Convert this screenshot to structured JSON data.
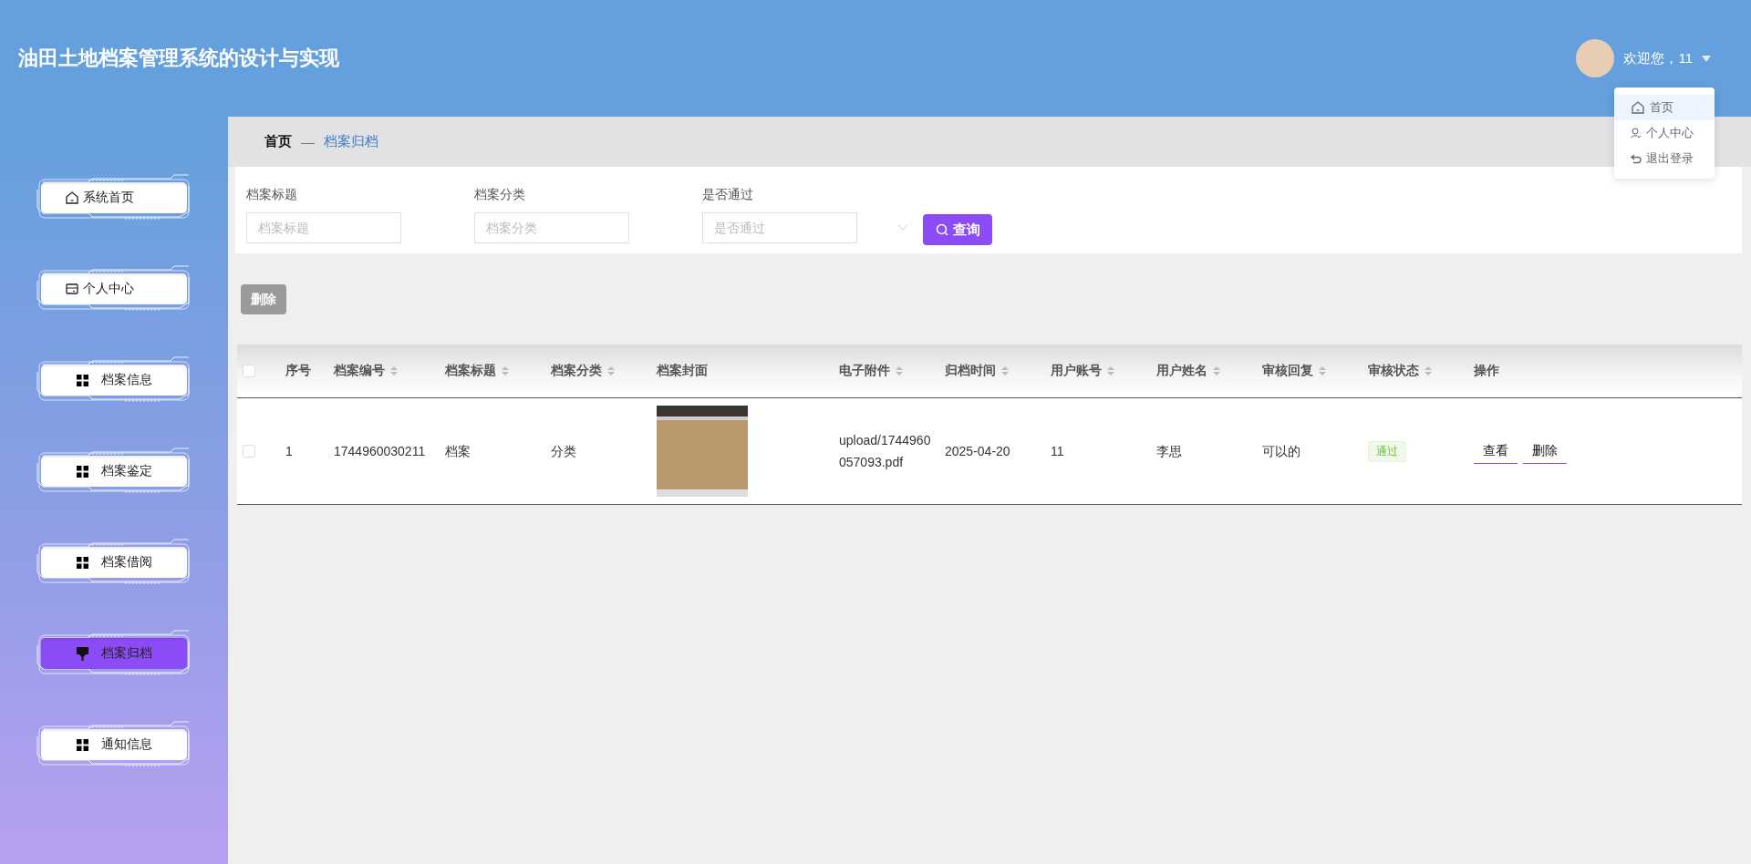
{
  "header": {
    "title": "油田土地档案管理系统的设计与实现",
    "greeting": "欢迎您，11",
    "menu": [
      {
        "label": "首页",
        "kind": "home",
        "selected": true
      },
      {
        "label": "个人中心",
        "kind": "user",
        "selected": false
      },
      {
        "label": "退出登录",
        "kind": "back",
        "selected": false
      }
    ]
  },
  "sidebar": {
    "items": [
      {
        "label": "系统首页",
        "kind": "home",
        "selected": false
      },
      {
        "label": "个人中心",
        "kind": "card",
        "selected": false
      },
      {
        "label": "档案信息",
        "kind": "grid",
        "selected": false
      },
      {
        "label": "档案鉴定",
        "kind": "grid",
        "selected": false
      },
      {
        "label": "档案借阅",
        "kind": "grid",
        "selected": false
      },
      {
        "label": "档案归档",
        "kind": "brush",
        "selected": true
      },
      {
        "label": "通知信息",
        "kind": "grid",
        "selected": false
      }
    ]
  },
  "breadcrumb": [
    "首页",
    "—",
    "档案归档"
  ],
  "filters": [
    {
      "label": "档案标题",
      "placeholder": "档案标题",
      "kind": "input"
    },
    {
      "label": "档案分类",
      "placeholder": "档案分类",
      "kind": "input"
    },
    {
      "label": "是否通过",
      "placeholder": "是否通过",
      "kind": "select"
    }
  ],
  "search_button": "查询",
  "delete_button": "删除",
  "table": {
    "select_all": {
      "checked": false
    },
    "columns": [
      {
        "label": "序号",
        "sortable": false
      },
      {
        "label": "档案编号",
        "sortable": true
      },
      {
        "label": "档案标题",
        "sortable": true
      },
      {
        "label": "档案分类",
        "sortable": true
      },
      {
        "label": "档案封面",
        "sortable": false
      },
      {
        "label": "电子附件",
        "sortable": true
      },
      {
        "label": "归档时间",
        "sortable": true
      },
      {
        "label": "用户账号",
        "sortable": true
      },
      {
        "label": "用户姓名",
        "sortable": true
      },
      {
        "label": "审核回复",
        "sortable": true
      },
      {
        "label": "审核状态",
        "sortable": true
      },
      {
        "label": "操作",
        "sortable": false
      }
    ],
    "rows": [
      {
        "checked": false,
        "index": "1",
        "number": "1744960030211",
        "title": "档案",
        "category": "分类",
        "attachment": "upload/1744960\n057093.pdf",
        "date": "2025-04-20",
        "account": "11",
        "name": "李思",
        "reply": "可以的",
        "status": "通过",
        "actions": [
          "查看",
          "删除"
        ]
      }
    ]
  }
}
